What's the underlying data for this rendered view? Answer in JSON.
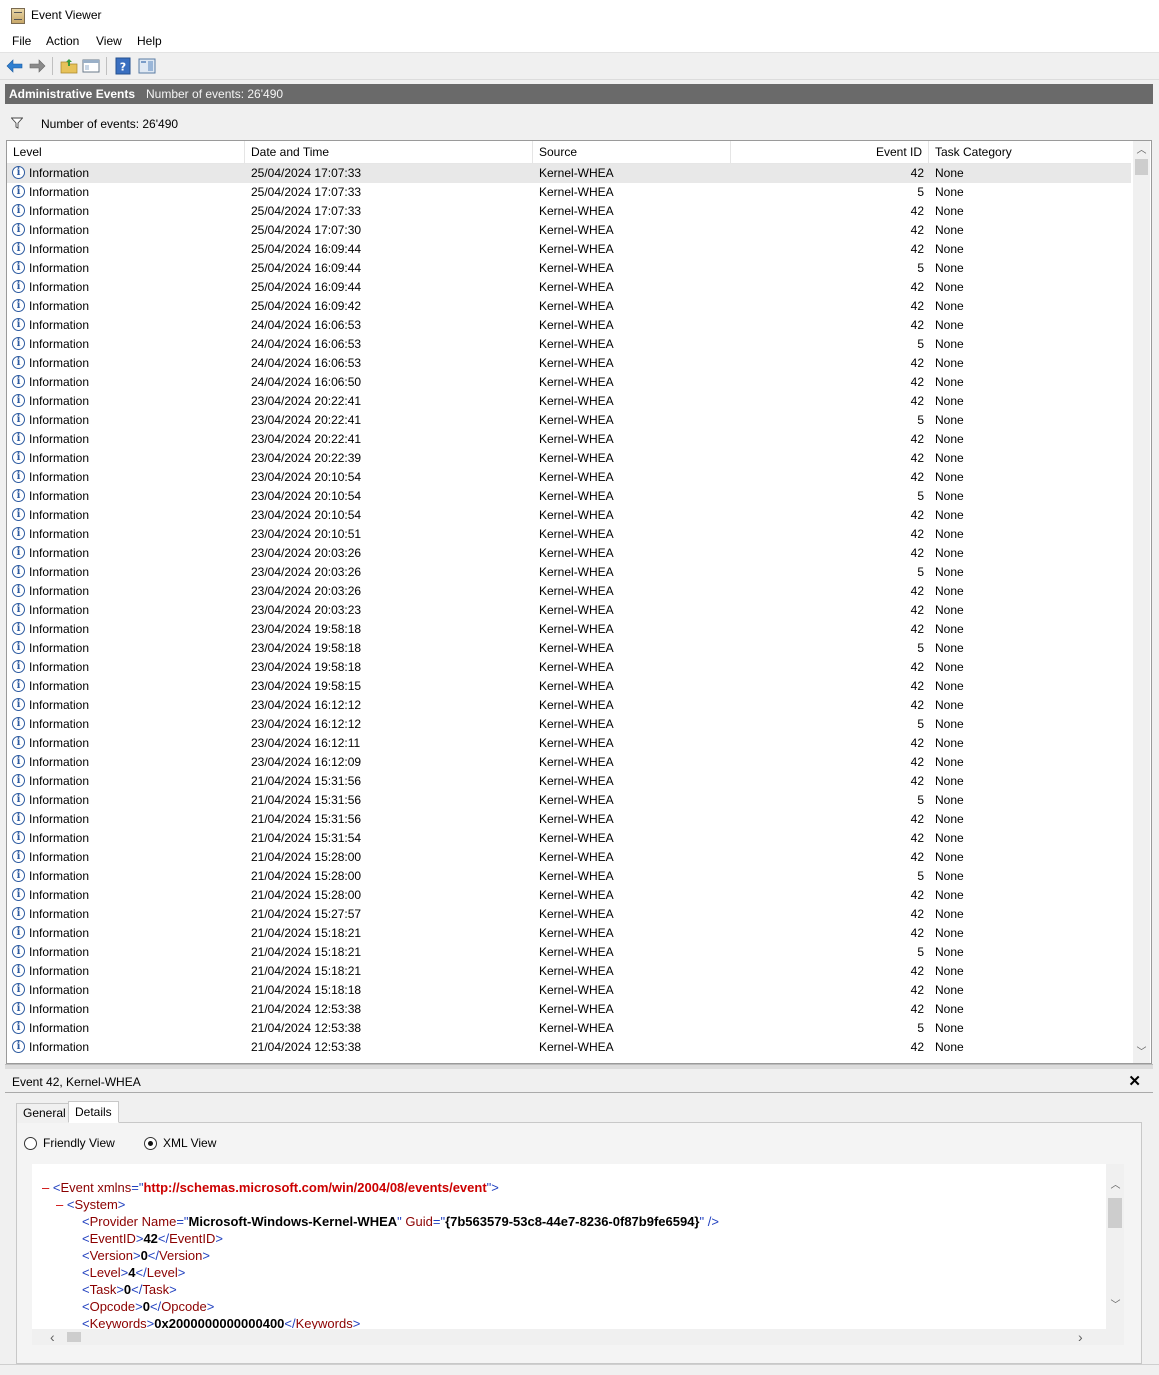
{
  "window": {
    "title": "Event Viewer"
  },
  "menu": [
    "File",
    "Action",
    "View",
    "Help"
  ],
  "toolbar_icons": [
    "back-arrow-icon",
    "forward-arrow-icon",
    "folder-up-icon",
    "show-hide-tree-icon",
    "help-icon",
    "action-pane-icon"
  ],
  "header": {
    "title": "Administrative Events",
    "count": "Number of events: 26'490"
  },
  "filter": {
    "text": "Number of events: 26'490"
  },
  "columns": [
    "Level",
    "Date and Time",
    "Source",
    "Event ID",
    "Task Category"
  ],
  "events": [
    {
      "level": "Information",
      "datetime": "25/04/2024 17:07:33",
      "source": "Kernel-WHEA",
      "id": "42",
      "category": "None"
    },
    {
      "level": "Information",
      "datetime": "25/04/2024 17:07:33",
      "source": "Kernel-WHEA",
      "id": "5",
      "category": "None"
    },
    {
      "level": "Information",
      "datetime": "25/04/2024 17:07:33",
      "source": "Kernel-WHEA",
      "id": "42",
      "category": "None"
    },
    {
      "level": "Information",
      "datetime": "25/04/2024 17:07:30",
      "source": "Kernel-WHEA",
      "id": "42",
      "category": "None"
    },
    {
      "level": "Information",
      "datetime": "25/04/2024 16:09:44",
      "source": "Kernel-WHEA",
      "id": "42",
      "category": "None"
    },
    {
      "level": "Information",
      "datetime": "25/04/2024 16:09:44",
      "source": "Kernel-WHEA",
      "id": "5",
      "category": "None"
    },
    {
      "level": "Information",
      "datetime": "25/04/2024 16:09:44",
      "source": "Kernel-WHEA",
      "id": "42",
      "category": "None"
    },
    {
      "level": "Information",
      "datetime": "25/04/2024 16:09:42",
      "source": "Kernel-WHEA",
      "id": "42",
      "category": "None"
    },
    {
      "level": "Information",
      "datetime": "24/04/2024 16:06:53",
      "source": "Kernel-WHEA",
      "id": "42",
      "category": "None"
    },
    {
      "level": "Information",
      "datetime": "24/04/2024 16:06:53",
      "source": "Kernel-WHEA",
      "id": "5",
      "category": "None"
    },
    {
      "level": "Information",
      "datetime": "24/04/2024 16:06:53",
      "source": "Kernel-WHEA",
      "id": "42",
      "category": "None"
    },
    {
      "level": "Information",
      "datetime": "24/04/2024 16:06:50",
      "source": "Kernel-WHEA",
      "id": "42",
      "category": "None"
    },
    {
      "level": "Information",
      "datetime": "23/04/2024 20:22:41",
      "source": "Kernel-WHEA",
      "id": "42",
      "category": "None"
    },
    {
      "level": "Information",
      "datetime": "23/04/2024 20:22:41",
      "source": "Kernel-WHEA",
      "id": "5",
      "category": "None"
    },
    {
      "level": "Information",
      "datetime": "23/04/2024 20:22:41",
      "source": "Kernel-WHEA",
      "id": "42",
      "category": "None"
    },
    {
      "level": "Information",
      "datetime": "23/04/2024 20:22:39",
      "source": "Kernel-WHEA",
      "id": "42",
      "category": "None"
    },
    {
      "level": "Information",
      "datetime": "23/04/2024 20:10:54",
      "source": "Kernel-WHEA",
      "id": "42",
      "category": "None"
    },
    {
      "level": "Information",
      "datetime": "23/04/2024 20:10:54",
      "source": "Kernel-WHEA",
      "id": "5",
      "category": "None"
    },
    {
      "level": "Information",
      "datetime": "23/04/2024 20:10:54",
      "source": "Kernel-WHEA",
      "id": "42",
      "category": "None"
    },
    {
      "level": "Information",
      "datetime": "23/04/2024 20:10:51",
      "source": "Kernel-WHEA",
      "id": "42",
      "category": "None"
    },
    {
      "level": "Information",
      "datetime": "23/04/2024 20:03:26",
      "source": "Kernel-WHEA",
      "id": "42",
      "category": "None"
    },
    {
      "level": "Information",
      "datetime": "23/04/2024 20:03:26",
      "source": "Kernel-WHEA",
      "id": "5",
      "category": "None"
    },
    {
      "level": "Information",
      "datetime": "23/04/2024 20:03:26",
      "source": "Kernel-WHEA",
      "id": "42",
      "category": "None"
    },
    {
      "level": "Information",
      "datetime": "23/04/2024 20:03:23",
      "source": "Kernel-WHEA",
      "id": "42",
      "category": "None"
    },
    {
      "level": "Information",
      "datetime": "23/04/2024 19:58:18",
      "source": "Kernel-WHEA",
      "id": "42",
      "category": "None"
    },
    {
      "level": "Information",
      "datetime": "23/04/2024 19:58:18",
      "source": "Kernel-WHEA",
      "id": "5",
      "category": "None"
    },
    {
      "level": "Information",
      "datetime": "23/04/2024 19:58:18",
      "source": "Kernel-WHEA",
      "id": "42",
      "category": "None"
    },
    {
      "level": "Information",
      "datetime": "23/04/2024 19:58:15",
      "source": "Kernel-WHEA",
      "id": "42",
      "category": "None"
    },
    {
      "level": "Information",
      "datetime": "23/04/2024 16:12:12",
      "source": "Kernel-WHEA",
      "id": "42",
      "category": "None"
    },
    {
      "level": "Information",
      "datetime": "23/04/2024 16:12:12",
      "source": "Kernel-WHEA",
      "id": "5",
      "category": "None"
    },
    {
      "level": "Information",
      "datetime": "23/04/2024 16:12:11",
      "source": "Kernel-WHEA",
      "id": "42",
      "category": "None"
    },
    {
      "level": "Information",
      "datetime": "23/04/2024 16:12:09",
      "source": "Kernel-WHEA",
      "id": "42",
      "category": "None"
    },
    {
      "level": "Information",
      "datetime": "21/04/2024 15:31:56",
      "source": "Kernel-WHEA",
      "id": "42",
      "category": "None"
    },
    {
      "level": "Information",
      "datetime": "21/04/2024 15:31:56",
      "source": "Kernel-WHEA",
      "id": "5",
      "category": "None"
    },
    {
      "level": "Information",
      "datetime": "21/04/2024 15:31:56",
      "source": "Kernel-WHEA",
      "id": "42",
      "category": "None"
    },
    {
      "level": "Information",
      "datetime": "21/04/2024 15:31:54",
      "source": "Kernel-WHEA",
      "id": "42",
      "category": "None"
    },
    {
      "level": "Information",
      "datetime": "21/04/2024 15:28:00",
      "source": "Kernel-WHEA",
      "id": "42",
      "category": "None"
    },
    {
      "level": "Information",
      "datetime": "21/04/2024 15:28:00",
      "source": "Kernel-WHEA",
      "id": "5",
      "category": "None"
    },
    {
      "level": "Information",
      "datetime": "21/04/2024 15:28:00",
      "source": "Kernel-WHEA",
      "id": "42",
      "category": "None"
    },
    {
      "level": "Information",
      "datetime": "21/04/2024 15:27:57",
      "source": "Kernel-WHEA",
      "id": "42",
      "category": "None"
    },
    {
      "level": "Information",
      "datetime": "21/04/2024 15:18:21",
      "source": "Kernel-WHEA",
      "id": "42",
      "category": "None"
    },
    {
      "level": "Information",
      "datetime": "21/04/2024 15:18:21",
      "source": "Kernel-WHEA",
      "id": "5",
      "category": "None"
    },
    {
      "level": "Information",
      "datetime": "21/04/2024 15:18:21",
      "source": "Kernel-WHEA",
      "id": "42",
      "category": "None"
    },
    {
      "level": "Information",
      "datetime": "21/04/2024 15:18:18",
      "source": "Kernel-WHEA",
      "id": "42",
      "category": "None"
    },
    {
      "level": "Information",
      "datetime": "21/04/2024 12:53:38",
      "source": "Kernel-WHEA",
      "id": "42",
      "category": "None"
    },
    {
      "level": "Information",
      "datetime": "21/04/2024 12:53:38",
      "source": "Kernel-WHEA",
      "id": "5",
      "category": "None"
    },
    {
      "level": "Information",
      "datetime": "21/04/2024 12:53:38",
      "source": "Kernel-WHEA",
      "id": "42",
      "category": "None"
    }
  ],
  "detail": {
    "title": "Event 42, Kernel-WHEA",
    "tabs": [
      "General",
      "Details"
    ],
    "active_tab": "Details",
    "views": [
      "Friendly View",
      "XML View"
    ],
    "selected_view": "XML View",
    "xml": {
      "event_tag": "Event",
      "xmlns_attr": "xmlns",
      "xmlns_value": "http://schemas.microsoft.com/win/2004/08/events/event",
      "system_tag": "System",
      "provider_tag": "Provider",
      "provider_name_attr": "Name",
      "provider_name": "Microsoft-Windows-Kernel-WHEA",
      "provider_guid_attr": "Guid",
      "provider_guid": "{7b563579-53c8-44e7-8236-0f87b9fe6594}",
      "fields": [
        {
          "tag": "EventID",
          "value": "42"
        },
        {
          "tag": "Version",
          "value": "0"
        },
        {
          "tag": "Level",
          "value": "4"
        },
        {
          "tag": "Task",
          "value": "0"
        },
        {
          "tag": "Opcode",
          "value": "0"
        },
        {
          "tag": "Keywords",
          "value": "0x2000000000000400"
        }
      ]
    }
  },
  "colors": {
    "header_bar": "#6a6a6a",
    "info_icon": "#2c5aa0",
    "xml_tag": "#8b0000",
    "xml_url": "#cc0000"
  }
}
